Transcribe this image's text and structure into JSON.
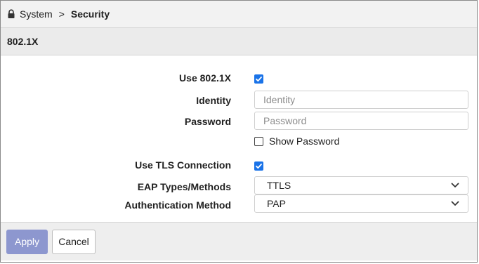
{
  "breadcrumb": {
    "parent": "System",
    "separator": ">",
    "current": "Security"
  },
  "section": {
    "title": "802.1X"
  },
  "form": {
    "use_8021x": {
      "label": "Use 802.1X",
      "checked": true
    },
    "identity": {
      "label": "Identity",
      "placeholder": "Identity",
      "value": ""
    },
    "password": {
      "label": "Password",
      "placeholder": "Password",
      "value": ""
    },
    "show_password": {
      "label": "Show Password",
      "checked": false
    },
    "use_tls": {
      "label": "Use TLS Connection",
      "checked": true
    },
    "eap_methods": {
      "label": "EAP Types/Methods",
      "value": "TTLS"
    },
    "auth_method": {
      "label": "Authentication Method",
      "value": "PAP"
    }
  },
  "footer": {
    "apply_label": "Apply",
    "cancel_label": "Cancel"
  },
  "colors": {
    "accent": "#1a73e8",
    "apply_button": "#8d97cf",
    "header_bg": "#f2f2f2"
  },
  "icons": {
    "breadcrumb": "lock-icon",
    "checkbox": "check-icon",
    "select": "chevron-down-icon"
  }
}
